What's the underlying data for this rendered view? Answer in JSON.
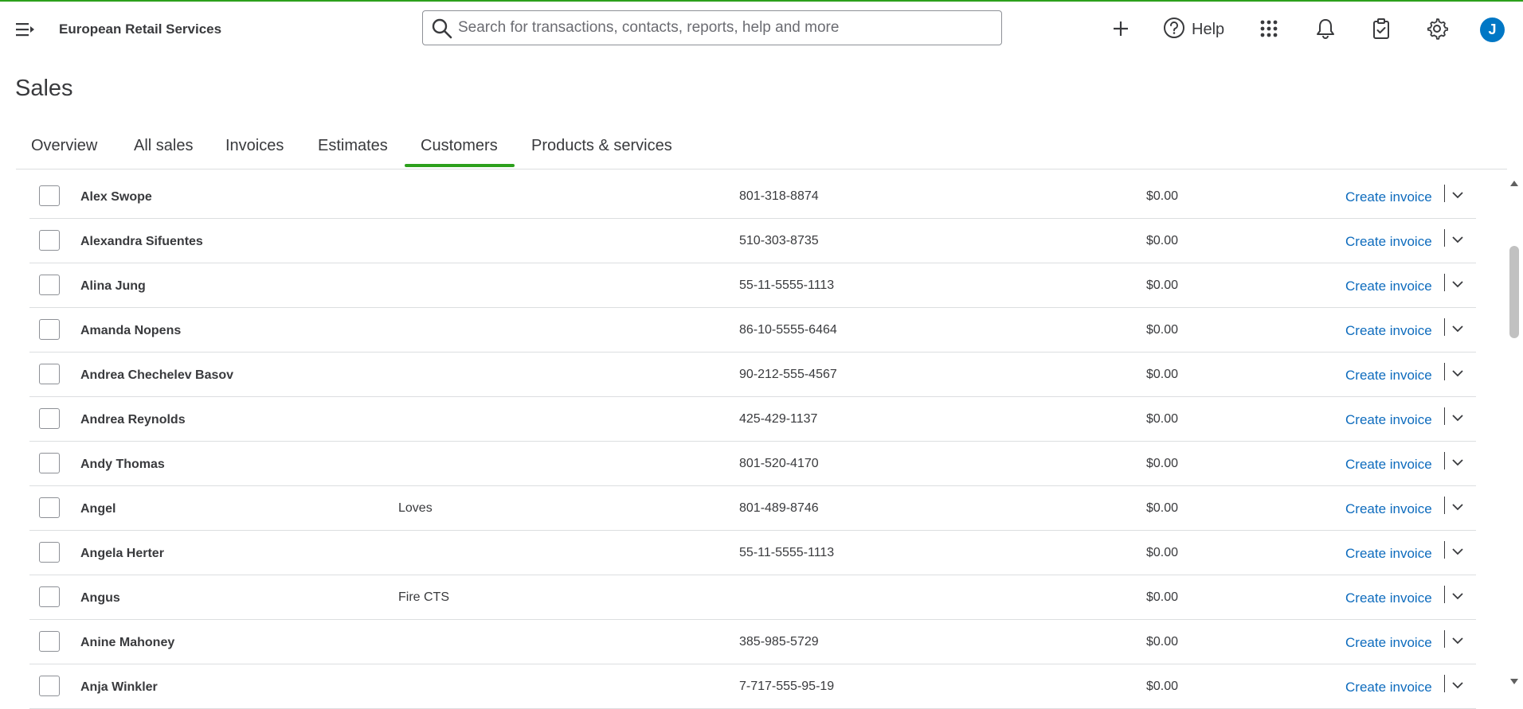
{
  "topbar": {
    "company_name": "European Retail Services",
    "search_placeholder": "Search for transactions, contacts, reports, help and more",
    "help_label": "Help",
    "avatar_initial": "J",
    "icons": [
      "menu-toggle-icon",
      "search-icon",
      "plus-icon",
      "help-icon",
      "apps-grid-icon",
      "bell-icon",
      "clipboard-check-icon",
      "gear-icon"
    ]
  },
  "page": {
    "title": "Sales"
  },
  "tabs": [
    {
      "label": "Overview"
    },
    {
      "label": "All sales"
    },
    {
      "label": "Invoices"
    },
    {
      "label": "Estimates"
    },
    {
      "label": "Customers",
      "active": true
    },
    {
      "label": "Products & services"
    }
  ],
  "customers": [
    {
      "name": "Alex Swope",
      "company": "",
      "phone": "801-318-8874",
      "balance": "$0.00",
      "action": "Create invoice"
    },
    {
      "name": "Alexandra Sifuentes",
      "company": "",
      "phone": "510-303-8735",
      "balance": "$0.00",
      "action": "Create invoice"
    },
    {
      "name": "Alina Jung",
      "company": "",
      "phone": "55-11-5555-1113",
      "balance": "$0.00",
      "action": "Create invoice"
    },
    {
      "name": "Amanda Nopens",
      "company": "",
      "phone": "86-10-5555-6464",
      "balance": "$0.00",
      "action": "Create invoice"
    },
    {
      "name": "Andrea Chechelev Basov",
      "company": "",
      "phone": "90-212-555-4567",
      "balance": "$0.00",
      "action": "Create invoice"
    },
    {
      "name": "Andrea Reynolds",
      "company": "",
      "phone": "425-429-1137",
      "balance": "$0.00",
      "action": "Create invoice"
    },
    {
      "name": "Andy Thomas",
      "company": "",
      "phone": "801-520-4170",
      "balance": "$0.00",
      "action": "Create invoice"
    },
    {
      "name": "Angel",
      "company": "Loves",
      "phone": "801-489-8746",
      "balance": "$0.00",
      "action": "Create invoice"
    },
    {
      "name": "Angela Herter",
      "company": "",
      "phone": "55-11-5555-1113",
      "balance": "$0.00",
      "action": "Create invoice"
    },
    {
      "name": "Angus",
      "company": "Fire CTS",
      "phone": "",
      "balance": "$0.00",
      "action": "Create invoice"
    },
    {
      "name": "Anine Mahoney",
      "company": "",
      "phone": "385-985-5729",
      "balance": "$0.00",
      "action": "Create invoice"
    },
    {
      "name": "Anja Winkler",
      "company": "",
      "phone": "7-717-555-95-19",
      "balance": "$0.00",
      "action": "Create invoice"
    }
  ],
  "colors": {
    "accent_green": "#2ca01c",
    "link_blue": "#0d6bbd",
    "avatar_blue": "#0077c5"
  }
}
